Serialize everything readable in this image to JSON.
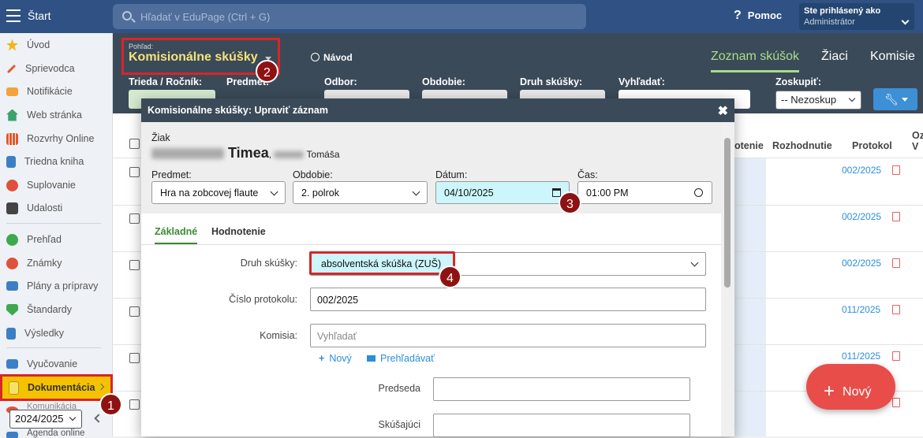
{
  "topbar": {
    "start_label": "Štart",
    "search_placeholder": "Hľadať v EduPage (Ctrl + G)",
    "help_label": "Pomoc",
    "help_icon": "?",
    "user_line1": "Ste prihlásený ako",
    "user_line2": "Administrátor"
  },
  "sidebar": {
    "items": [
      {
        "label": "Úvod",
        "icon": "star-icon",
        "color": "#f3b41b"
      },
      {
        "label": "Sprievodca",
        "icon": "wand-icon",
        "color": "#e35a37"
      },
      {
        "label": "Notifikácie",
        "icon": "envelope-icon",
        "color": "#f2a33a"
      },
      {
        "label": "Web stránka",
        "icon": "home-icon",
        "color": "#3aa36a"
      },
      {
        "label": "Rozvrhy Online",
        "icon": "grid-icon",
        "color": "#e4572e"
      },
      {
        "label": "Triedna kniha",
        "icon": "book-icon",
        "color": "#3d7fc4"
      },
      {
        "label": "Suplovanie",
        "icon": "person-icon",
        "color": "#e0513b"
      },
      {
        "label": "Udalosti",
        "icon": "calendar-icon",
        "color": "#444"
      },
      {
        "label": "Prehľad",
        "icon": "check-icon",
        "color": "#3fa84f"
      },
      {
        "label": "Známky",
        "icon": "grade-icon",
        "color": "#e0513b"
      },
      {
        "label": "Plány a prípravy",
        "icon": "briefcase-icon",
        "color": "#3d7fc4"
      },
      {
        "label": "Štandardy",
        "icon": "shield-icon",
        "color": "#3fa84f"
      },
      {
        "label": "Výsledky",
        "icon": "chart-icon",
        "color": "#3d7fc4"
      },
      {
        "label": "Vyučovanie",
        "icon": "board-icon",
        "color": "#3d7fc4"
      },
      {
        "label": "Dokumentácia",
        "icon": "document-icon",
        "color": "#f7e06a"
      },
      {
        "label": "Komunikácia",
        "icon": "chat-icon",
        "color": "#e0513b"
      },
      {
        "label": "Agenda online",
        "icon": "agenda-icon",
        "color": "#3d7fc4"
      }
    ],
    "year": "2024/2025"
  },
  "view": {
    "label": "Pohľad:",
    "title": "Komisionálne skúšky",
    "navod": "Návod"
  },
  "tabs": [
    "Zoznam skúšok",
    "Žiaci",
    "Komisie"
  ],
  "filters": {
    "labels": [
      "Trieda / Ročník:",
      "Predmet:",
      "Odbor:",
      "Obdobie:",
      "Druh skúšky:",
      "Vyhľadať:",
      "Zoskupiť:"
    ],
    "group_value": "-- Nezoskup"
  },
  "table": {
    "headers": [
      "otenie",
      "Rozhodnutie",
      "Protokol",
      "Oz V"
    ],
    "protocols": [
      "002/2025",
      "002/2025",
      "002/2025",
      "011/2025",
      "011/2025"
    ]
  },
  "fab_label": "Nový",
  "dialog": {
    "title": "Komisionálne skúšky: Upraviť záznam",
    "student_label": "Žiak",
    "student_first": "Timea",
    "student_parent": "Tomáša",
    "subject_label": "Predmet:",
    "subject_value": "Hra na zobcovej flaute",
    "period_label": "Obdobie:",
    "period_value": "2. polrok",
    "date_label": "Dátum:",
    "date_value": "04/10/2025",
    "time_label": "Čas:",
    "time_value": "01:00 PM",
    "tab_basic": "Základné",
    "tab_eval": "Hodnotenie",
    "type_label": "Druh skúšky:",
    "type_value": "absolventská skúška (ZUŠ)",
    "protocol_label": "Číslo protokolu:",
    "protocol_value": "002/2025",
    "committee_label": "Komisia:",
    "committee_placeholder": "Vyhľadať",
    "new_link": "Nový",
    "browse_link": "Prehľadávať",
    "chair_label": "Predseda",
    "examiner_label": "Skúšajúci"
  },
  "badges": [
    "1",
    "2",
    "3",
    "4"
  ]
}
